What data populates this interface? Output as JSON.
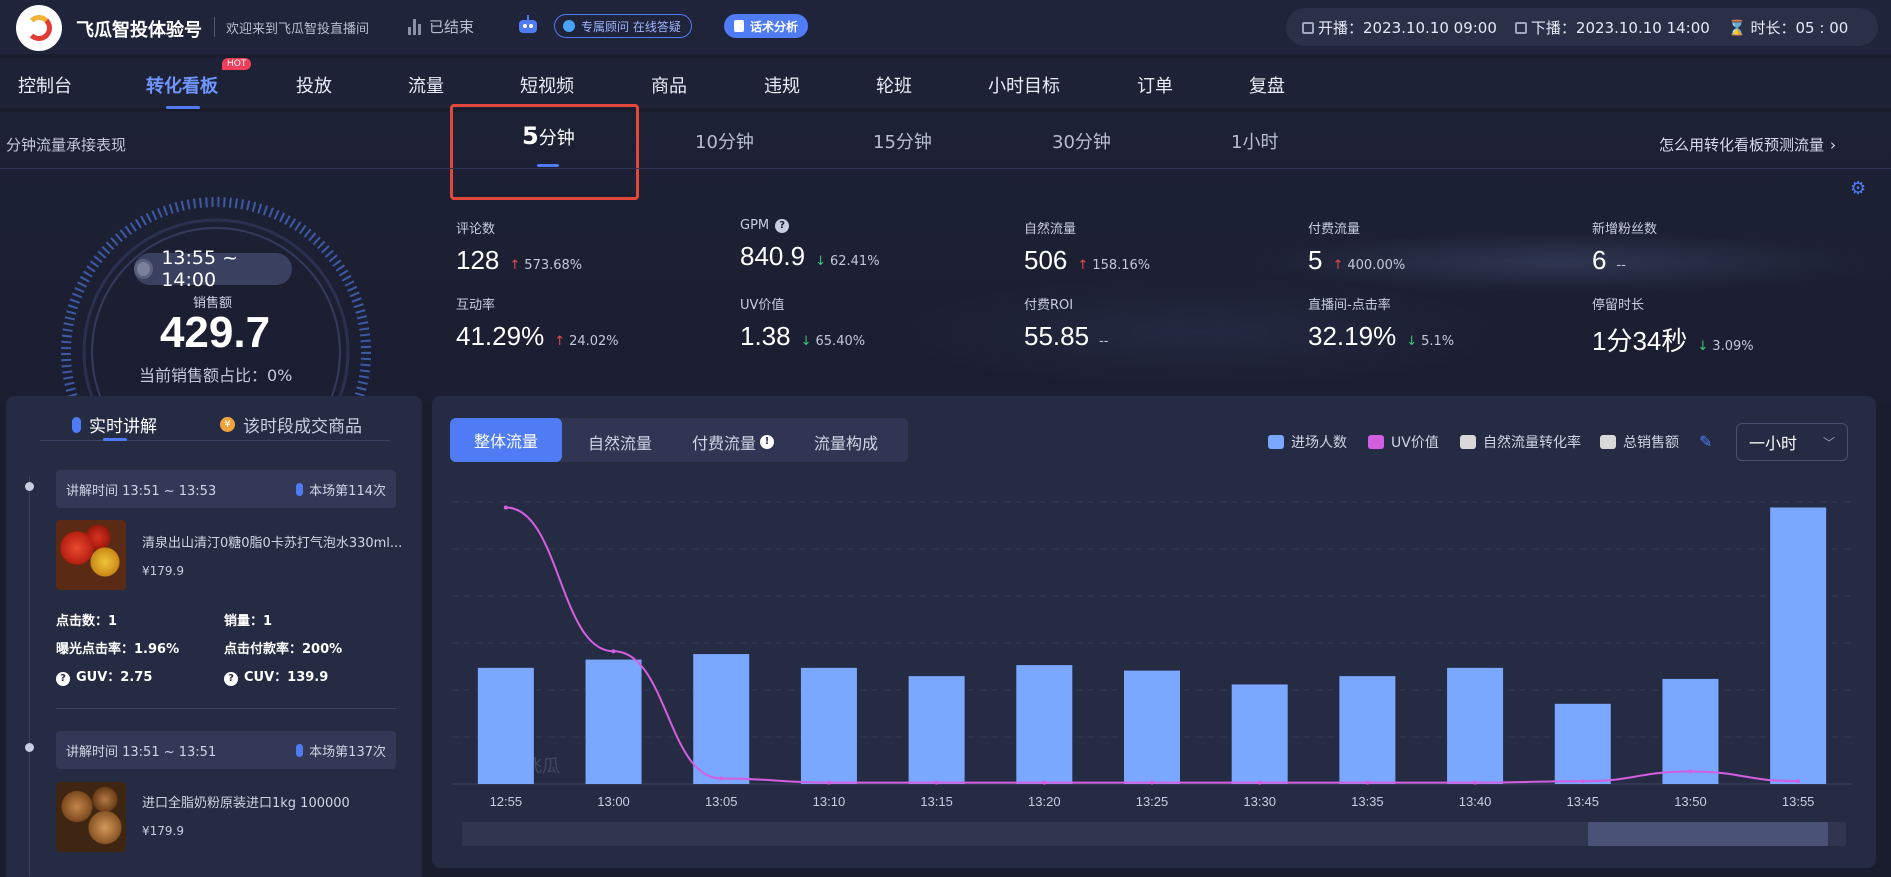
{
  "header": {
    "brand": "飞瓜智投体验号",
    "welcome": "欢迎来到飞瓜智投直播间",
    "status": "已结束",
    "consult": "专属顾问 在线答疑",
    "speech": "话术分析",
    "start_label": "开播：",
    "start": "2023.10.10 09:00",
    "end_label": "下播：",
    "end": "2023.10.10 14:00",
    "duration_label": "时长：",
    "duration": "05 : 00"
  },
  "nav": {
    "items": [
      "控制台",
      "转化看板",
      "投放",
      "流量",
      "短视频",
      "商品",
      "违规",
      "轮班",
      "小时目标",
      "订单",
      "复盘"
    ],
    "hot": "HOT"
  },
  "intervals": {
    "label": "分钟流量承接表现",
    "active_num": "5",
    "active_unit": "分钟",
    "items": [
      "10分钟",
      "15分钟",
      "30分钟",
      "1小时"
    ],
    "howto": "怎么用转化看板预测流量"
  },
  "gauge": {
    "time": "13:55 ~ 14:00",
    "sales_label": "销售额",
    "sales_value": "429.7",
    "ratio": "当前销售额占比：0%"
  },
  "metrics": [
    {
      "label": "评论数",
      "value": "128",
      "change": "573.68%",
      "dir": "up"
    },
    {
      "label": "GPM",
      "value": "840.9",
      "change": "62.41%",
      "dir": "down"
    },
    {
      "label": "自然流量",
      "value": "506",
      "change": "158.16%",
      "dir": "up"
    },
    {
      "label": "付费流量",
      "value": "5",
      "change": "400.00%",
      "dir": "up"
    },
    {
      "label": "新增粉丝数",
      "value": "6",
      "change": "--",
      "dir": "none"
    },
    {
      "label": "互动率",
      "value": "41.29%",
      "change": "24.02%",
      "dir": "up"
    },
    {
      "label": "UV价值",
      "value": "1.38",
      "change": "65.40%",
      "dir": "down"
    },
    {
      "label": "付费ROI",
      "value": "55.85",
      "change": "--",
      "dir": "none"
    },
    {
      "label": "直播间-点击率",
      "value": "32.19%",
      "change": "5.1%",
      "dir": "down"
    },
    {
      "label": "停留时长",
      "value": "1分34秒",
      "change": "3.09%",
      "dir": "down"
    }
  ],
  "left": {
    "tab_live": "实时讲解",
    "tab_goods": "该时段成交商品",
    "cards": [
      {
        "time": "讲解时间 13:51 ~ 13:53",
        "count": "本场第114次",
        "name": "清泉出山清汀0糖0脂0卡苏打气泡水330ml...",
        "price": "¥179.9",
        "clicks": "点击数：1",
        "sales": "销量：1",
        "ctr": "曝光点击率：1.96%",
        "cvr": "点击付款率：200%",
        "guv": "GUV：2.75",
        "cuv": "CUV：139.9"
      },
      {
        "time": "讲解时间 13:51 ~ 13:51",
        "count": "本场第137次",
        "name": "进口全脂奶粉原装进口1kg 100000",
        "price": "¥179.9"
      }
    ]
  },
  "chart_panel": {
    "tabs": [
      "整体流量",
      "自然流量",
      "付费流量",
      "流量构成"
    ],
    "legend": [
      {
        "label": "进场人数",
        "color": "#7aa7ff"
      },
      {
        "label": "UV价值",
        "color": "#d35fe0"
      },
      {
        "label": "自然流量转化率",
        "color": "#d8d8d8"
      },
      {
        "label": "总销售额",
        "color": "#d8d8d8"
      }
    ],
    "dropdown": "一小时",
    "watermark": "飞瓜"
  },
  "chart_data": {
    "type": "bar",
    "categories": [
      "12:55",
      "13:00",
      "13:05",
      "13:10",
      "13:15",
      "13:20",
      "13:25",
      "13:30",
      "13:35",
      "13:40",
      "13:45",
      "13:50",
      "13:55"
    ],
    "series": [
      {
        "name": "进场人数",
        "type": "bar",
        "values": [
          42,
          45,
          47,
          42,
          39,
          43,
          41,
          36,
          39,
          42,
          29,
          38,
          100
        ]
      },
      {
        "name": "UV价值",
        "type": "line",
        "values": [
          100,
          48,
          2,
          0.5,
          0.5,
          0.5,
          0.5,
          0.5,
          0.5,
          0.5,
          1,
          4.5,
          1
        ]
      }
    ],
    "ylim": [
      0,
      115
    ],
    "grid": true
  }
}
